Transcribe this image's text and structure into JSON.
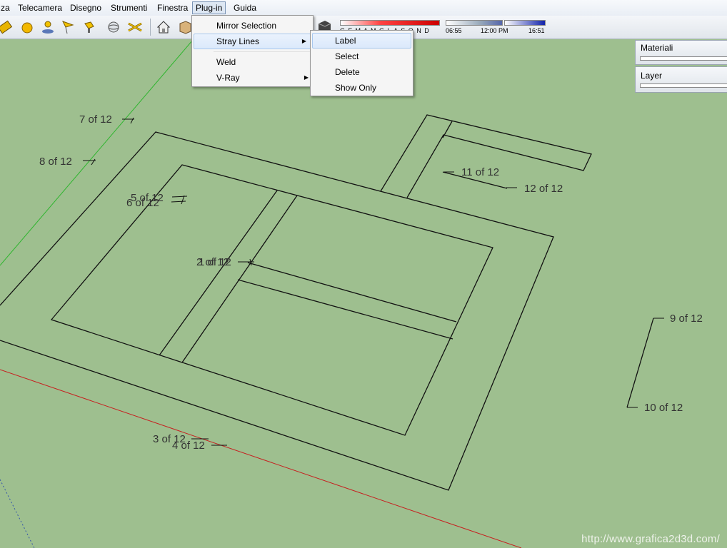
{
  "menubar": {
    "items": [
      "za",
      "Telecamera",
      "Disegno",
      "Strumenti",
      "Finestra",
      "Plug-in",
      "Guida"
    ],
    "active": "Plug-in"
  },
  "toolbar": {
    "icons": [
      "tape-measure-icon",
      "sphere-icon",
      "walk-icon",
      "flag-icon",
      "paint-icon",
      "orbit-icon",
      "section-icon",
      "house-icon",
      "box-icon"
    ],
    "shadow": {
      "months": "G F M A M G L A S O N D",
      "time_start": "06:55",
      "time_mid": "12:00 PM",
      "time_end": "16:51"
    }
  },
  "plugin_menu": {
    "items": [
      {
        "label": "Mirror Selection",
        "submenu": false
      },
      {
        "label": "Stray Lines",
        "submenu": true,
        "highlighted": true
      },
      {
        "label": "Weld",
        "submenu": false
      },
      {
        "label": "V-Ray",
        "submenu": true
      }
    ]
  },
  "stray_lines_menu": {
    "items": [
      {
        "label": "Label",
        "highlighted": true
      },
      {
        "label": "Select"
      },
      {
        "label": "Delete"
      },
      {
        "label": "Show Only"
      }
    ]
  },
  "panels": {
    "materials": "Materiali",
    "layers": "Layer"
  },
  "labels": [
    "1 of 12",
    "2 of 12",
    "3 of 12",
    "4 of 12",
    "5 of 12",
    "6 of 12",
    "7 of 12",
    "8 of 12",
    "9 of 12",
    "10 of 12",
    "11 of 12",
    "12 of 12"
  ],
  "watermark": "http://www.grafica2d3d.com/"
}
